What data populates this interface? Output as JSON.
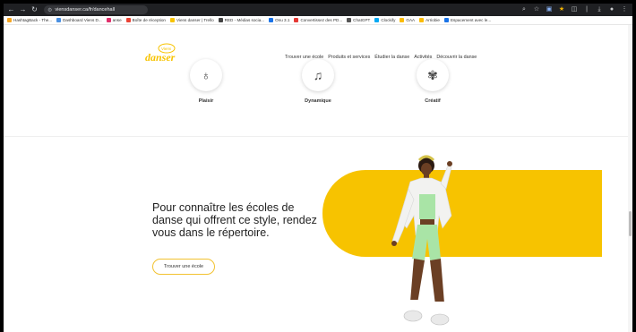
{
  "browser": {
    "url": "viensdanser.ca/fr/dancehall",
    "bookmarks": [
      {
        "label": "HashtagBack - The...",
        "color": "#f5a623"
      },
      {
        "label": "Dashboard Viens D...",
        "color": "#4a90e2"
      },
      {
        "label": "anse",
        "color": "#e1306c"
      },
      {
        "label": "Boîte de réception",
        "color": "#ea4335"
      },
      {
        "label": "Viens danser | Trello",
        "color": "#f7c300"
      },
      {
        "label": "RED - Médias socia...",
        "color": "#444444"
      },
      {
        "label": "Onu 3.1",
        "color": "#1a73e8"
      },
      {
        "label": "Convertissez des PD...",
        "color": "#e53935"
      },
      {
        "label": "ChatGPT",
        "color": "#555555"
      },
      {
        "label": "Clockify",
        "color": "#03a9f4"
      },
      {
        "label": "GAA",
        "color": "#fbbc04"
      },
      {
        "label": "Arriobie",
        "color": "#fbbc04"
      },
      {
        "label": "Espacement avec le...",
        "color": "#1a73e8"
      }
    ]
  },
  "site": {
    "logo_text": "Viens danser",
    "nav": [
      "Trouver une école",
      "Produits et services",
      "Étudier la danse",
      "Activités",
      "Découvrir la danse"
    ]
  },
  "features": [
    {
      "label": "Plaisir",
      "icon": "♁"
    },
    {
      "label": "Dynamique",
      "icon": "♫"
    },
    {
      "label": "Créatif",
      "icon": "✾"
    }
  ],
  "hero": {
    "text": "Pour connaître les écoles de danse qui offrent ce style, rendez vous dans le répertoire.",
    "cta_label": "Trouver une école"
  },
  "colors": {
    "accent": "#f7c300",
    "text": "#222222"
  }
}
